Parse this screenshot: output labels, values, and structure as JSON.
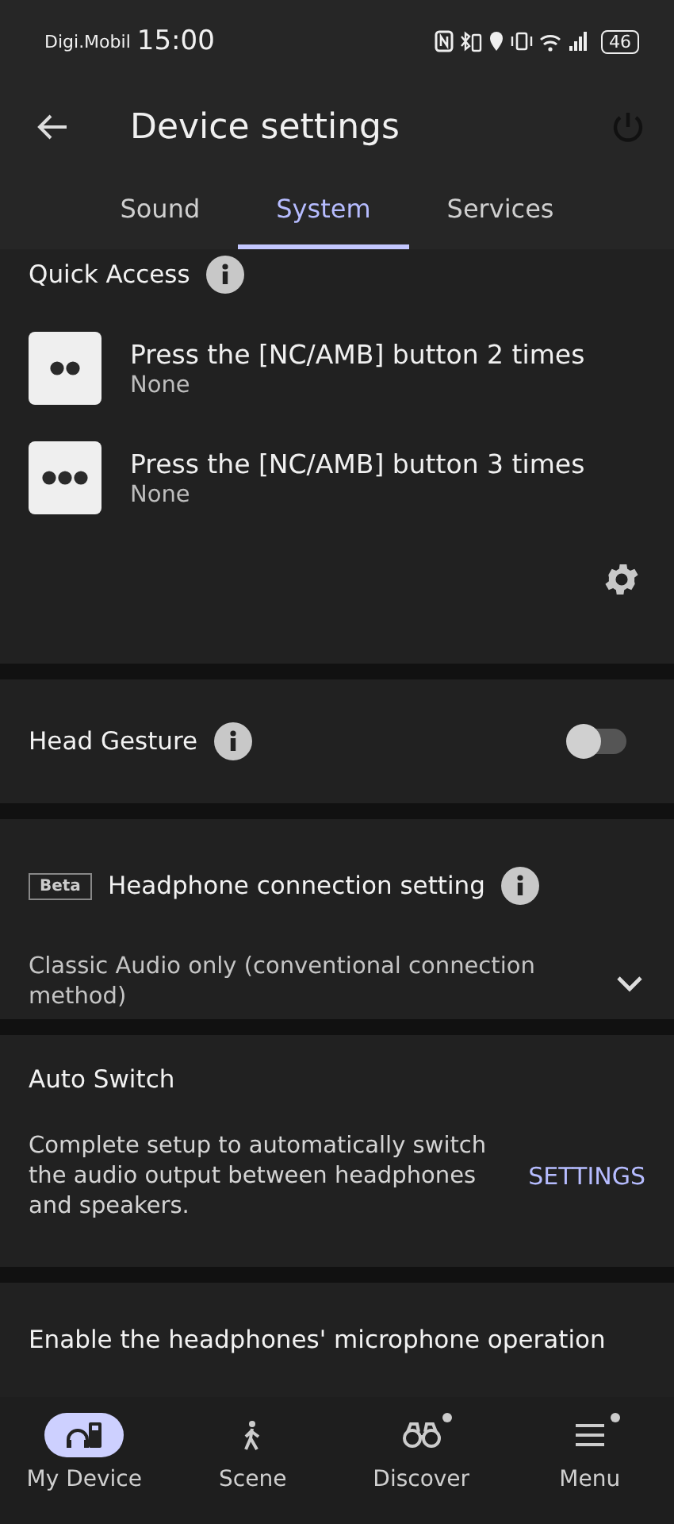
{
  "status_bar": {
    "carrier": "Digi.Mobil",
    "time": "15:00",
    "battery": "46"
  },
  "header": {
    "title": "Device settings"
  },
  "tabs": [
    {
      "label": "Sound",
      "selected": false
    },
    {
      "label": "System",
      "selected": true
    },
    {
      "label": "Services",
      "selected": false
    }
  ],
  "quick_access": {
    "title": "Quick Access",
    "items": [
      {
        "kind": "double",
        "title": "Press the [NC/AMB] button 2 times",
        "value": "None"
      },
      {
        "kind": "triple",
        "title": "Press the [NC/AMB] button 3 times",
        "value": "None"
      }
    ]
  },
  "head_gesture": {
    "label": "Head Gesture",
    "on": false
  },
  "connection": {
    "badge": "Beta",
    "label": "Headphone connection setting",
    "value": "Classic Audio only (conventional connection method)"
  },
  "auto_switch": {
    "title": "Auto Switch",
    "description": "Complete setup to automatically switch the audio output between headphones and speakers.",
    "action": "SETTINGS"
  },
  "microphone": {
    "label": "Enable the headphones' microphone operation"
  },
  "bottom_nav": [
    {
      "kind": "device",
      "label": "My Device",
      "selected": true,
      "dot": false
    },
    {
      "kind": "scene",
      "label": "Scene",
      "selected": false,
      "dot": false
    },
    {
      "kind": "discover",
      "label": "Discover",
      "selected": false,
      "dot": true
    },
    {
      "kind": "menu",
      "label": "Menu",
      "selected": false,
      "dot": true
    }
  ]
}
